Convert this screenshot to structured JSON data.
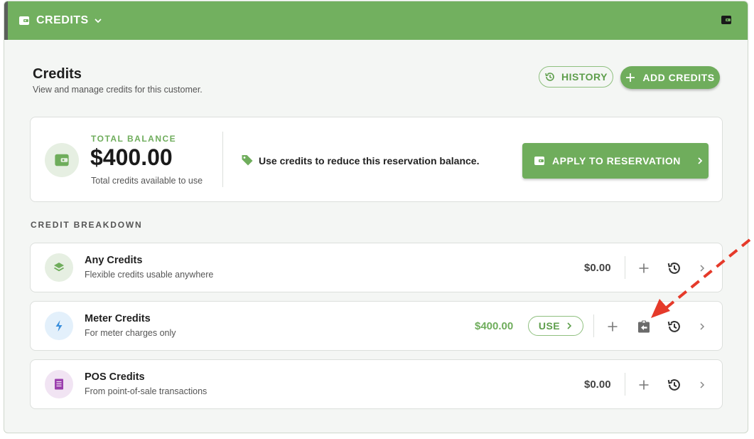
{
  "header": {
    "title": "CREDITS"
  },
  "page": {
    "title": "Credits",
    "subtitle": "View and manage credits for this customer.",
    "history_label": "HISTORY",
    "add_credits_label": "ADD CREDITS"
  },
  "balance": {
    "label": "TOTAL BALANCE",
    "amount": "$400.00",
    "sub": "Total credits available to use",
    "hint": "Use credits to reduce this reservation balance.",
    "apply_label": "APPLY TO RESERVATION"
  },
  "breakdown": {
    "label": "CREDIT BREAKDOWN",
    "items": [
      {
        "name": "Any Credits",
        "desc": "Flexible credits usable anywhere",
        "amount": "$0.00"
      },
      {
        "name": "Meter Credits",
        "desc": "For meter charges only",
        "amount": "$400.00",
        "use_label": "USE"
      },
      {
        "name": "POS Credits",
        "desc": "From point-of-sale transactions",
        "amount": "$0.00"
      }
    ]
  },
  "colors": {
    "brand_green": "#72b05f",
    "annotation_red": "#e53a2a"
  }
}
